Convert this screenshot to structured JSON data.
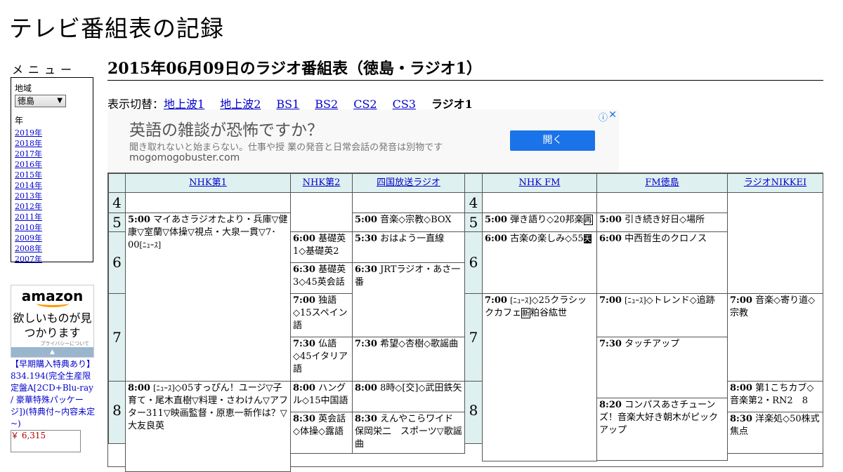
{
  "site_title": "テレビ番組表の記録",
  "menu": {
    "heading": "メニュー",
    "region_label": "地域",
    "region_value": "徳島",
    "year_label": "年",
    "years": [
      "2019年",
      "2018年",
      "2017年",
      "2016年",
      "2015年",
      "2014年",
      "2013年",
      "2012年",
      "2011年",
      "2010年",
      "2009年",
      "2008年",
      "2007年"
    ]
  },
  "amazon": {
    "logo": "amazon",
    "copy": "欲しいものが見つかります",
    "privacy": "プライバシーについて",
    "product_title": "【早期購入特典あり】834.194(完全生産限定盤A[2CD+Blu-ray / 豪華特殊パッケージ])(特典付~内容未定~)",
    "product_price": "￥ 6,315"
  },
  "page_title": "2015年06月09日のラジオ番組表（徳島・ラジオ1）",
  "switch": {
    "label": "表示切替：",
    "links": [
      "地上波1",
      "地上波2",
      "BS1",
      "BS2",
      "CS2",
      "CS3"
    ],
    "current": "ラジオ1"
  },
  "ad": {
    "headline": "英語の雑談が恐怖ですか？",
    "body": "聞き取れないと始まらない。仕事や授 業の発音と日常会話の発音は別物です",
    "url": "mogomogobuster.com",
    "button": "開く"
  },
  "channels": [
    "NHK第1",
    "NHK第2",
    "四国放送ラジオ",
    "NHK FM",
    "FM徳島",
    "ラジオNIKKEI"
  ],
  "hours": [
    "4",
    "5",
    "6",
    "7",
    "8"
  ],
  "programs": {
    "nhk1_0500_time": "5:00",
    "nhk1_0500_title": "マイあさラジオたより・兵庫▽健康▽室蘭▽体操▽視点・大泉一貫▽7･00",
    "nhk1_0800_time": "8:00",
    "nhk1_0800_title": "◇05すっぴん！ユージ▽子育て・尾木直樹▽料理・さわけん▽アフター311▽映画監督・原恵一新作は？▽大友良英",
    "nhk2_0600_time": "6:00",
    "nhk2_0600_title": "基礎英1◇基礎英2",
    "nhk2_0630_time": "6:30",
    "nhk2_0630_title": "基礎英3◇45英会話",
    "nhk2_0700_time": "7:00",
    "nhk2_0700_title": "独語◇15スペイン語",
    "nhk2_0730_time": "7:30",
    "nhk2_0730_title": "仏語◇45イタリア語",
    "nhk2_0800_time": "8:00",
    "nhk2_0800_title": "ハングル◇15中国語",
    "nhk2_0830_time": "8:30",
    "nhk2_0830_title": "英会話◇体操◇露語",
    "jrt_0500_time": "5:00",
    "jrt_0500_title": "音楽◇宗教◇BOX",
    "jrt_0530_time": "5:30",
    "jrt_0530_title": "おはよう一直線",
    "jrt_0630_time": "6:30",
    "jrt_0630_title": "JRTラジオ・あさ一番",
    "jrt_0730_time": "7:30",
    "jrt_0730_title": "希望◇杏樹◇歌謡曲",
    "jrt_0800_time": "8:00",
    "jrt_0800_title": "8時◇[交]◇武田鉄矢",
    "jrt_0830_time": "8:30",
    "jrt_0830_title": "えんやこらワイド保岡栄二　スポーツ▽歌謡曲",
    "fm_0500_time": "5:00",
    "fm_0500_title": "弾き語り◇20邦楽",
    "fm_0600_time": "6:00",
    "fm_0600_title": "古楽の楽しみ◇55",
    "fm_0700_time": "7:00",
    "fm_0700_title": "◇25クラシックカフェ",
    "fm_0700_title2": "粕谷紘世",
    "fmt_0500_time": "5:00",
    "fmt_0500_title": "引き続き好日◇場所",
    "fmt_0600_time": "6:00",
    "fmt_0600_title": "中西哲生のクロノス",
    "fmt_0700_time": "7:00",
    "fmt_0700_title": "◇トレンド◇追跡",
    "fmt_0730_time": "7:30",
    "fmt_0730_title": "タッチアップ",
    "fmt_0820_time": "8:20",
    "fmt_0820_title": "コンパスあさチューンズ！音楽大好き朝木がピックアップ",
    "nikkei_0700_time": "7:00",
    "nikkei_0700_title": "音楽◇寄り道◇宗教",
    "nikkei_0800_time": "8:00",
    "nikkei_0800_title": "第1こちカブ◇音楽第2・RN2　8",
    "nikkei_0830_time": "8:30",
    "nikkei_0830_title": "洋楽処◇50株式焦点",
    "news_tag": "[ﾆｭｰｽ]",
    "re_tag": "再",
    "ten_tag": "天",
    "shin_tag": "新"
  },
  "colors": {
    "header_bg": "#dff0f0",
    "link": "#0000cc",
    "ad_button": "#1a73e8",
    "amazon_orange": "#ff9900"
  }
}
